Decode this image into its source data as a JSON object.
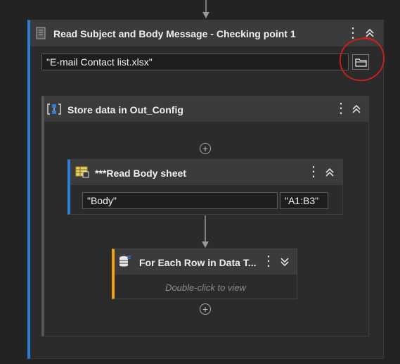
{
  "outer_activity": {
    "title": "Read Subject and Body Message - Checking point 1",
    "file_path": "\"E-mail Contact list.xlsx\"",
    "menu_icon": "more-vert-icon",
    "collapse_icon": "chevron-up-double-icon",
    "browse_icon": "folder-icon",
    "accent_color": "#2d7fd6"
  },
  "sequence": {
    "title": "Store data in Out_Config",
    "icon": "sequence-icon",
    "menu_icon": "more-vert-icon",
    "collapse_icon": "chevron-up-double-icon"
  },
  "read_range": {
    "title": "***Read Body sheet",
    "sheet_value": "\"Body\"",
    "range_value": "\"A1:B3\"",
    "icon": "excel-read-range-icon",
    "accent_color": "#2d7fd6"
  },
  "for_each": {
    "title": "For Each Row in Data T...",
    "hint": "Double-click to view",
    "icon": "datatable-icon",
    "expand_icon": "chevron-down-double-icon",
    "accent_color": "#f0a30a"
  },
  "add_icon": "add-activity-icon",
  "annotation": {
    "shape": "red-hand-drawn-circle",
    "color": "#d21f1f"
  }
}
